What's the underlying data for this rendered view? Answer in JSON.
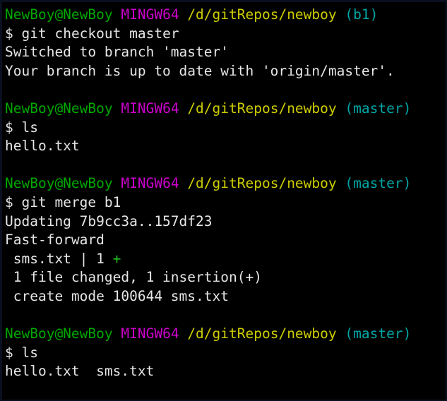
{
  "terminal": {
    "title": "MINGW64 /d/gitRepos/newboy",
    "colors": {
      "background": "#000000",
      "foreground": "#e6e6e6",
      "user_host": "#00a800",
      "shell_name": "#cc00cc",
      "path": "#cdcd00",
      "branch": "#00a6a6",
      "added": "#22c022",
      "border": "#0b1020"
    },
    "prompt": {
      "user_host": "NewBoy@NewBoy",
      "shell_name": "MINGW64",
      "path": "/d/gitRepos/newboy",
      "dollar": "$"
    },
    "blocks": [
      {
        "branch": "(b1)",
        "command": "git checkout master",
        "output": [
          {
            "text": "Switched to branch 'master'"
          },
          {
            "text": "Your branch is up to date with 'origin/master'."
          }
        ]
      },
      {
        "branch": "(master)",
        "command": "ls",
        "output": [
          {
            "text": "hello.txt"
          }
        ]
      },
      {
        "branch": "(master)",
        "command": "git merge b1",
        "output": [
          {
            "text": "Updating 7b9cc3a..157df23"
          },
          {
            "text": "Fast-forward"
          },
          {
            "text": " sms.txt | 1 ",
            "suffix": "+",
            "suffix_color": "added"
          },
          {
            "text": " 1 file changed, 1 insertion(+)"
          },
          {
            "text": " create mode 100644 sms.txt"
          }
        ]
      },
      {
        "branch": "(master)",
        "command": "ls",
        "output": [
          {
            "text": "hello.txt  sms.txt"
          }
        ]
      }
    ]
  }
}
